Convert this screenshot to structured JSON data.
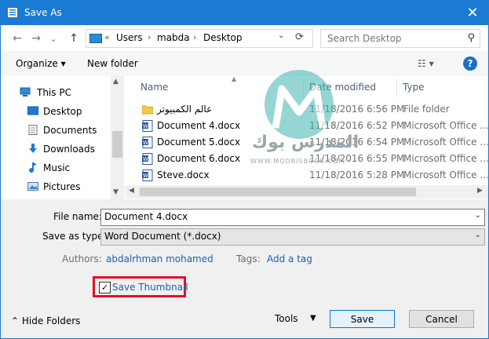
{
  "window": {
    "title": "Save As",
    "close_glyph": "✕",
    "accent_color": "#1b7ad1"
  },
  "nav": {
    "back_glyph": "←",
    "forward_glyph": "→",
    "recent_glyph": "⌄",
    "up_glyph": "↑"
  },
  "address": {
    "prefix": "«",
    "crumbs": [
      "Users",
      "mabda",
      "Desktop"
    ],
    "separator": "›"
  },
  "search": {
    "placeholder": "Search Desktop"
  },
  "toolbar": {
    "organize_label": "Organize ▾",
    "new_folder_label": "New folder",
    "view_glyph": "☷ ▾",
    "help_glyph": "?"
  },
  "sidebar": {
    "items": [
      {
        "label": "This PC",
        "icon": "computer-icon"
      },
      {
        "label": "Desktop",
        "icon": "desktop-icon"
      },
      {
        "label": "Documents",
        "icon": "documents-icon"
      },
      {
        "label": "Downloads",
        "icon": "downloads-icon"
      },
      {
        "label": "Music",
        "icon": "music-icon"
      },
      {
        "label": "Pictures",
        "icon": "pictures-icon"
      }
    ]
  },
  "file_list": {
    "columns": {
      "name": "Name",
      "date": "Date modified",
      "type": "Type"
    },
    "rows": [
      {
        "name": "عالم الكمبيوتر",
        "date": "11/18/2016 6:56 PM",
        "type": "File folder",
        "icon": "folder-icon"
      },
      {
        "name": "Document 4.docx",
        "date": "11/18/2016 6:52 PM",
        "type": "Microsoft Office ...",
        "icon": "word-doc-icon"
      },
      {
        "name": "Document 5.docx",
        "date": "11/18/2016 6:54 PM",
        "type": "Microsoft Office ...",
        "icon": "word-doc-icon"
      },
      {
        "name": "Document 6.docx",
        "date": "11/18/2016 6:55 PM",
        "type": "Microsoft Office ...",
        "icon": "word-doc-icon"
      },
      {
        "name": "Steve.docx",
        "date": "11/18/2016 5:28 PM",
        "type": "Microsoft Office ...",
        "icon": "word-doc-icon"
      }
    ]
  },
  "form": {
    "file_name_label": "File name:",
    "file_name_value": "Document 4.docx",
    "save_type_label": "Save as type:",
    "save_type_value": "Word Document (*.docx)",
    "authors_label": "Authors:",
    "authors_value": "abdalrhman mohamed",
    "tags_label": "Tags:",
    "tags_value": "Add a tag",
    "thumbnail_label": "Save Thumbnail",
    "thumbnail_checked": true,
    "highlight_color": "#e3102a"
  },
  "footer": {
    "hide_folders_label": "Hide Folders",
    "tools_label": "Tools",
    "save_label": "Save",
    "cancel_label": "Cancel"
  },
  "watermark": {
    "text": "المدرس بوك",
    "sub": "WWW.MODRISBOOK.COM"
  }
}
